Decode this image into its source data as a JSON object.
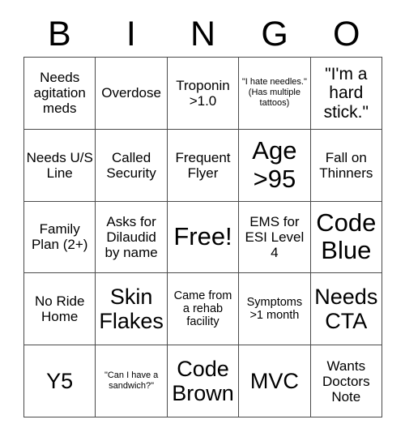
{
  "card": {
    "header_letters": [
      "B",
      "I",
      "N",
      "G",
      "O"
    ],
    "rows": [
      [
        {
          "text": "Needs agitation meds",
          "size": "md"
        },
        {
          "text": "Overdose",
          "size": "md"
        },
        {
          "text": "Troponin >1.0",
          "size": "md"
        },
        {
          "text": "\"I hate needles.\" (Has multiple tattoos)",
          "size": "xs"
        },
        {
          "text": "\"I'm a hard stick.\"",
          "size": "lg"
        }
      ],
      [
        {
          "text": "Needs U/S Line",
          "size": "md"
        },
        {
          "text": "Called Security",
          "size": "md"
        },
        {
          "text": "Frequent Flyer",
          "size": "md"
        },
        {
          "text": "Age >95",
          "size": "xxl"
        },
        {
          "text": "Fall on Thinners",
          "size": "md"
        }
      ],
      [
        {
          "text": "Family Plan (2+)",
          "size": "md"
        },
        {
          "text": "Asks for Dilaudid by name",
          "size": "md"
        },
        {
          "text": "Free!",
          "size": "xxl"
        },
        {
          "text": "EMS for ESI Level 4",
          "size": "md"
        },
        {
          "text": "Code Blue",
          "size": "xxl"
        }
      ],
      [
        {
          "text": "No Ride Home",
          "size": "md"
        },
        {
          "text": "Skin Flakes",
          "size": "xl"
        },
        {
          "text": "Came from a rehab facility",
          "size": "sm"
        },
        {
          "text": "Symptoms >1 month",
          "size": "sm"
        },
        {
          "text": "Needs CTA",
          "size": "xl"
        }
      ],
      [
        {
          "text": "Y5",
          "size": "xl"
        },
        {
          "text": "\"Can I have a sandwich?\"",
          "size": "xs"
        },
        {
          "text": "Code Brown",
          "size": "xl"
        },
        {
          "text": "MVC",
          "size": "xl"
        },
        {
          "text": "Wants Doctors Note",
          "size": "md"
        }
      ]
    ]
  },
  "colors": {
    "background": "#ffffff",
    "border": "#4a4a4a",
    "text": "#000000"
  }
}
